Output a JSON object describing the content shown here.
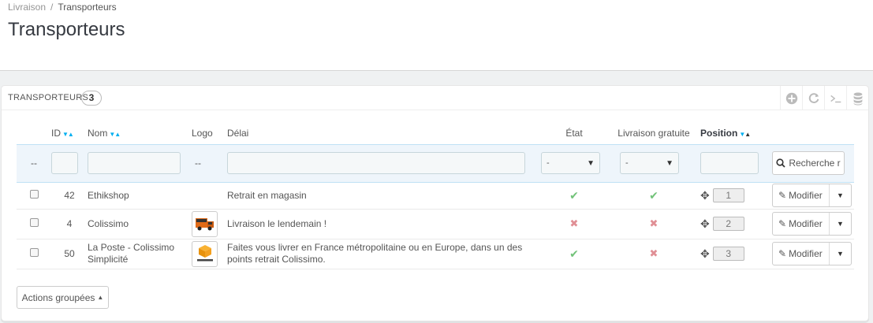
{
  "breadcrumb": {
    "parent": "Livraison",
    "separator": "/",
    "current": "Transporteurs"
  },
  "page": {
    "title": "Transporteurs"
  },
  "panel": {
    "title": "Transporteurs",
    "count": "3"
  },
  "toolbar": {
    "icons": [
      "add-icon",
      "refresh-icon",
      "sql-query-icon",
      "database-icon"
    ]
  },
  "table": {
    "columns": {
      "id": "ID",
      "name": "Nom",
      "logo": "Logo",
      "delay": "Délai",
      "status": "État",
      "free_shipping": "Livraison gratuite",
      "position": "Position"
    },
    "filters": {
      "select_label": "-",
      "select_caret": "▼",
      "checkbox_placeholder": "--",
      "logo_placeholder": "--",
      "search_button": "Recherche r"
    },
    "rows": [
      {
        "id": "42",
        "name": "Ethikshop",
        "delay": "Retrait en magasin",
        "status": "enabled",
        "free_shipping": "yes",
        "position": "1",
        "logo": ""
      },
      {
        "id": "4",
        "name": "Colissimo",
        "delay": "Livraison le lendemain !",
        "status": "disabled",
        "free_shipping": "no",
        "position": "2",
        "logo": "colissimo-truck-logo"
      },
      {
        "id": "50",
        "name": "La Poste - Colissimo Simplicité",
        "delay": "Faites vous livrer en France métropolitaine ou en Europe, dans un des points retrait Colissimo.",
        "status": "enabled",
        "free_shipping": "no",
        "position": "3",
        "logo": "colissimo-logo"
      }
    ],
    "row_action": "Modifier"
  },
  "bulk": {
    "label": "Actions groupées"
  },
  "colors": {
    "accent": "#00aff0",
    "check": "#72c279",
    "cross": "#e08f95",
    "filter_bg": "#eef5fb"
  }
}
